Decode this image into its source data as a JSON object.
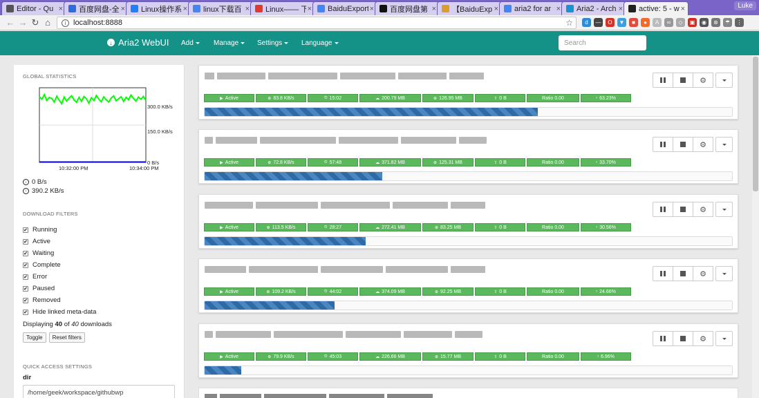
{
  "browser": {
    "tabs": [
      {
        "title": "Editor - Qu",
        "icon": "editor-icon",
        "color": "#555555",
        "active": false
      },
      {
        "title": "百度网盘-全",
        "icon": "baidu-icon",
        "color": "#2f6ce0",
        "active": false
      },
      {
        "title": "Linux操作系",
        "icon": "zhihu-icon",
        "color": "#1e80ff",
        "active": false
      },
      {
        "title": "linux下载百",
        "icon": "google-icon",
        "color": "#4285f4",
        "active": false
      },
      {
        "title": "Linux—— 下",
        "icon": "csdn-icon",
        "color": "#e03a2f",
        "active": false
      },
      {
        "title": "BaiduExport",
        "icon": "google-icon",
        "color": "#4285f4",
        "active": false
      },
      {
        "title": "百度网盘第",
        "icon": "medium-icon",
        "color": "#111111",
        "active": false
      },
      {
        "title": "【BaiduExp",
        "icon": "chrome-icon",
        "color": "#dd9d2a",
        "active": false
      },
      {
        "title": "aria2 for ar",
        "icon": "google-icon",
        "color": "#4285f4",
        "active": false
      },
      {
        "title": "Aria2 - Arch",
        "icon": "arch-icon",
        "color": "#1793d1",
        "active": false
      },
      {
        "title": "active: 5 - w",
        "icon": "aria2-icon",
        "color": "#222222",
        "active": true
      }
    ],
    "profile": "Luke",
    "url": "localhost:8888"
  },
  "navbar": {
    "brand": "Aria2 WebUI",
    "menus": [
      "Add",
      "Manage",
      "Settings",
      "Language"
    ],
    "search_placeholder": "Search"
  },
  "sidebar": {
    "global_statistics_title": "GLOBAL STATISTICS",
    "chart_data": {
      "type": "line",
      "ylabels": [
        "300.0 KB/s",
        "150.0 KB/s",
        "0 B/s"
      ],
      "xlabels": [
        "10:32:00 PM",
        "10:34:00 PM"
      ],
      "series": [
        {
          "color": "#00ff00",
          "values": [
            370,
            355,
            382,
            348,
            365,
            360,
            340,
            372,
            350,
            330,
            368,
            345,
            362,
            375,
            352,
            338,
            366,
            344,
            371,
            359,
            333,
            364,
            348,
            377,
            356,
            341,
            369,
            352,
            339,
            363,
            374,
            347,
            358,
            370,
            343,
            366,
            352,
            379,
            361,
            345,
            368,
            355,
            371,
            349
          ]
        },
        {
          "color": "#0000cc",
          "values": [
            2,
            2,
            2,
            2,
            2,
            2,
            2,
            2,
            2,
            2,
            2,
            2,
            2,
            2,
            2,
            2,
            2,
            2,
            2,
            2,
            2,
            2,
            2,
            2,
            2,
            2,
            2,
            2,
            2,
            2,
            2,
            2,
            2,
            2,
            2,
            2,
            2,
            2,
            2,
            2,
            2,
            2,
            2,
            2
          ]
        }
      ],
      "ylim": [
        0,
        420
      ]
    },
    "download_speed": "0 B/s",
    "upload_speed": "390.2 KB/s",
    "download_filters_title": "DOWNLOAD FILTERS",
    "filters": [
      "Running",
      "Active",
      "Waiting",
      "Complete",
      "Error",
      "Paused",
      "Removed",
      "Hide linked meta-data"
    ],
    "displaying_prefix": "Displaying",
    "displaying_count": "40",
    "displaying_of": "of",
    "displaying_total": "40",
    "displaying_suffix": "downloads",
    "toggle_label": "Toggle",
    "reset_label": "Reset filters",
    "quick_access_title": "QUICK ACCESS SETTINGS",
    "dir_label": "dir",
    "dir_value": "/home/geek/workspace/githubwp"
  },
  "downloads": [
    {
      "status": "Active",
      "speed": "83.8 KB/s",
      "eta": "15:02",
      "downloaded": "200.79 MB",
      "size": "126.95 MB",
      "upload": "0 B",
      "ratio": "Ratio 0.00",
      "progress_label": "63.23%",
      "progress": 0.6323
    },
    {
      "status": "Active",
      "speed": "72.8 KB/s",
      "eta": "57:48",
      "downloaded": "371.82 MB",
      "size": "125.31 MB",
      "upload": "0 B",
      "ratio": "Ratio 0.00",
      "progress_label": "33.70%",
      "progress": 0.337
    },
    {
      "status": "Active",
      "speed": "113.5 KB/s",
      "eta": "28:27",
      "downloaded": "272.41 MB",
      "size": "83.25 MB",
      "upload": "0 B",
      "ratio": "Ratio 0.00",
      "progress_label": "30.56%",
      "progress": 0.3056
    },
    {
      "status": "Active",
      "speed": "109.2 KB/s",
      "eta": "44:02",
      "downloaded": "374.09 MB",
      "size": "92.25 MB",
      "upload": "0 B",
      "ratio": "Ratio 0.00",
      "progress_label": "24.66%",
      "progress": 0.2466
    },
    {
      "status": "Active",
      "speed": "79.9 KB/s",
      "eta": "45:03",
      "downloaded": "226.66 MB",
      "size": "15.77 MB",
      "upload": "0 B",
      "ratio": "Ratio 0.00",
      "progress_label": "6.96%",
      "progress": 0.0696
    }
  ]
}
